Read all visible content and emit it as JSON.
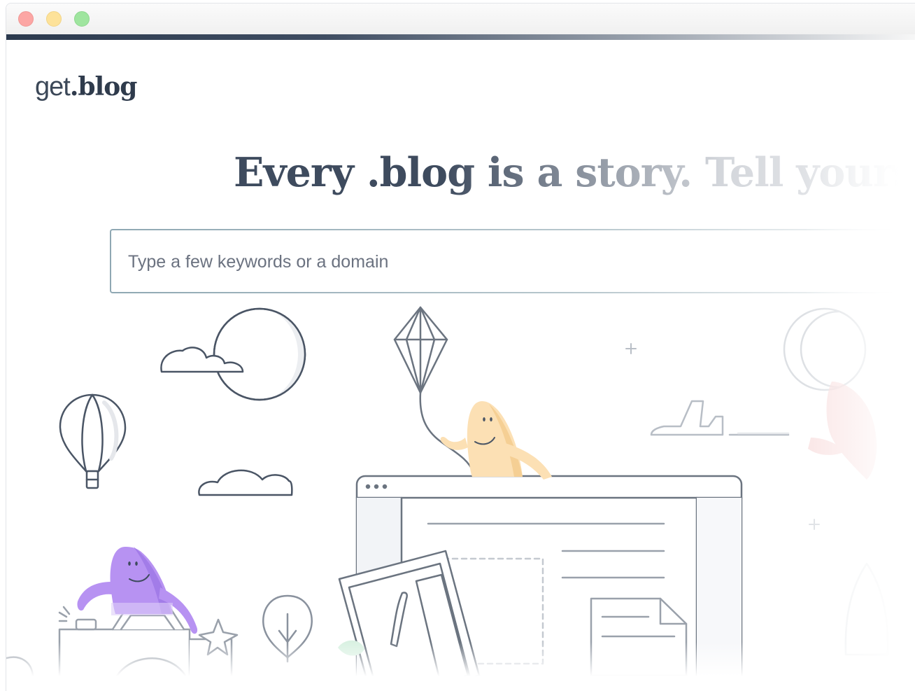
{
  "window": {
    "controls": [
      "close-button",
      "minimize-button",
      "zoom-button"
    ]
  },
  "logo": {
    "part1": "get",
    "part2": ".blog"
  },
  "headline": "Every .blog is a story. Tell yours.",
  "search": {
    "placeholder": "Type a few keywords or a domain",
    "value": ""
  },
  "colors": {
    "dark": "#3e4b5e",
    "accent_bar": "#2c3a4e",
    "purple_character": "#b38ef0",
    "yellow_character": "#fbd89a"
  }
}
